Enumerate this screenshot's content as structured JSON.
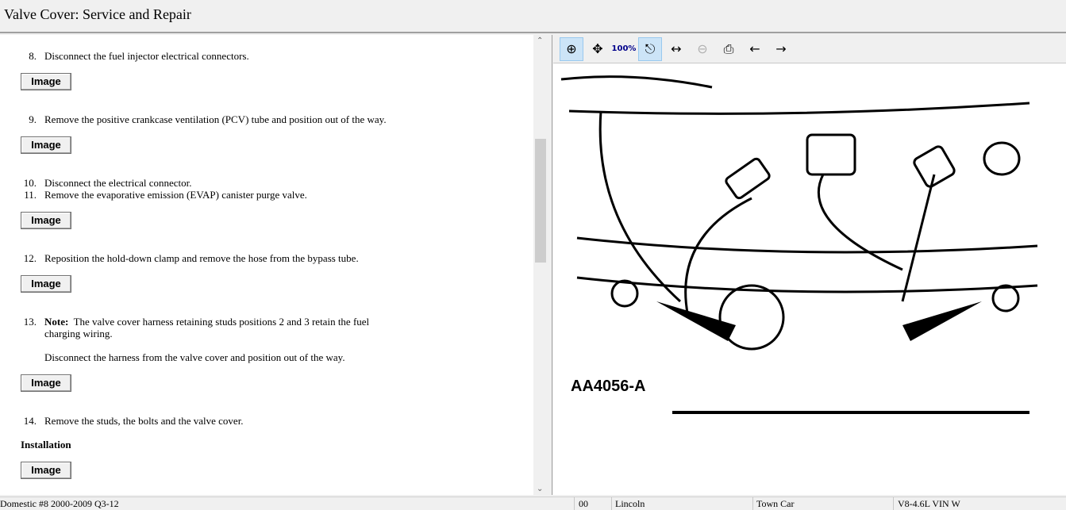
{
  "title": "Valve Cover:  Service and Repair",
  "steps": [
    {
      "n": "8.",
      "text": "Disconnect the fuel injector electrical connectors."
    },
    {
      "n": "9.",
      "text": "Remove the positive crankcase ventilation (PCV) tube and position out of the way."
    },
    {
      "n": "10.",
      "text": "Disconnect the electrical connector."
    },
    {
      "n": "11.",
      "text": "Remove the evaporative emission (EVAP) canister purge valve."
    },
    {
      "n": "12.",
      "text": "Reposition the hold-down clamp and remove the hose from the bypass tube."
    },
    {
      "n": "13.",
      "note_label": "Note:",
      "text": "The valve cover harness retaining studs positions 2 and 3 retain the fuel charging wiring.",
      "extra": "Disconnect the harness from the valve cover and position out of the way."
    },
    {
      "n": "14.",
      "text": "Remove the studs, the bolts and the valve cover."
    }
  ],
  "installation_heading": "Installation",
  "image_button_label": "Image",
  "toolbar": [
    "zoom-in",
    "pan",
    "actual-size-100%",
    "zoom-fit",
    "zoom-width",
    "zoom-out",
    "print",
    "previous-image",
    "next-image"
  ],
  "diagram_label": "AA4056-A",
  "status": {
    "source": "Domestic #8 2000-2009 Q3-12",
    "code": "00",
    "make": "Lincoln",
    "model": "Town Car",
    "engine": "V8-4.6L VIN W"
  }
}
